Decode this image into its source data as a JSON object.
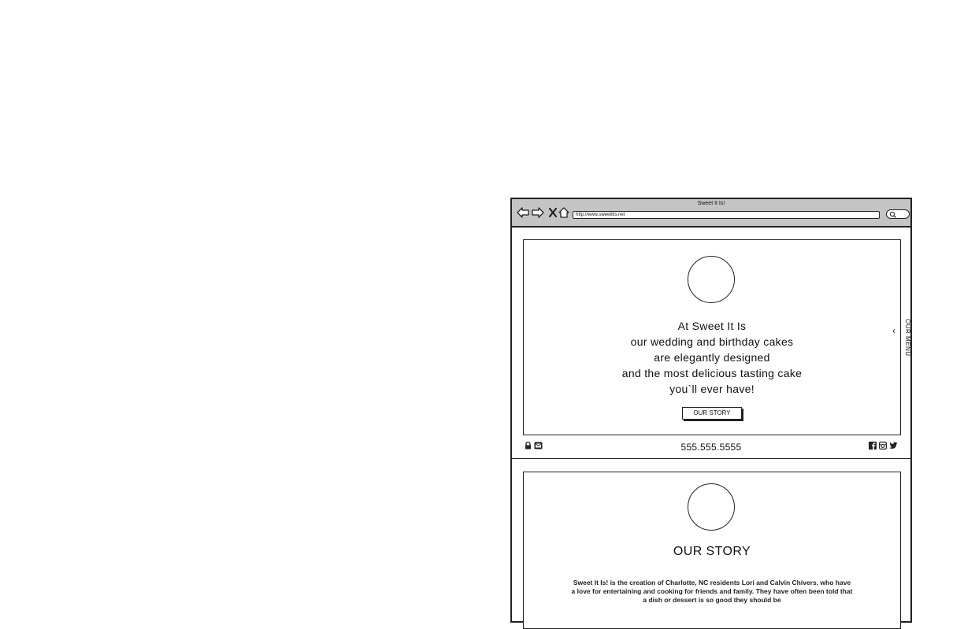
{
  "window": {
    "title": "Sweet It Is!",
    "url": "http://www.sweetitis.net",
    "nav_icons": [
      "back-arrow-icon",
      "forward-arrow-icon",
      "close-icon",
      "home-icon"
    ],
    "search_icon": "search-icon"
  },
  "hero": {
    "tagline": [
      "At Sweet It Is",
      "our wedding and birthday cakes",
      "are elegantly designed",
      "and the most delicious tasting cake",
      "you`ll ever have!"
    ],
    "button_label": "OUR STORY",
    "side_tab_label": "OUR MENU"
  },
  "footer": {
    "phone": "555.555.5555",
    "left_icons": [
      "lock-icon",
      "mail-icon"
    ],
    "social_icons": [
      "facebook-icon",
      "instagram-icon",
      "twitter-icon"
    ]
  },
  "story": {
    "title": "OUR STORY",
    "body": "Sweet It Is! is the creation of Charlotte, NC residents Lori and Calvin Chivers, who have a love for entertaining and cooking for friends and family. They have often been told that a dish or dessert is so good they should be"
  }
}
